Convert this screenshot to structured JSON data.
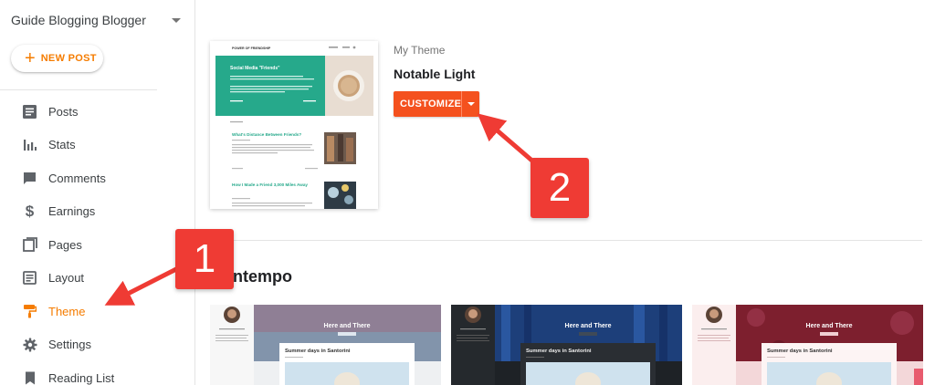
{
  "sidebar": {
    "blog_name": "Guide Blogging Blogger",
    "new_post_label": "NEW POST",
    "items": [
      {
        "label": "Posts",
        "icon": "posts-icon"
      },
      {
        "label": "Stats",
        "icon": "stats-icon"
      },
      {
        "label": "Comments",
        "icon": "comments-icon"
      },
      {
        "label": "Earnings",
        "icon": "dollar-icon"
      },
      {
        "label": "Pages",
        "icon": "pages-icon"
      },
      {
        "label": "Layout",
        "icon": "layout-icon"
      },
      {
        "label": "Theme",
        "icon": "paint-roller-icon",
        "active": true
      },
      {
        "label": "Settings",
        "icon": "gear-icon"
      },
      {
        "label": "Reading List",
        "icon": "bookmark-icon"
      }
    ]
  },
  "theme": {
    "my_theme_label": "My Theme",
    "name": "Notable Light",
    "customize_label": "CUSTOMIZE",
    "preview": {
      "site_title": "POWER OF FRIENDSHIP",
      "featured_title": "Social Media \"Friends\"",
      "post_1_title": "What's Distance Between Friends?",
      "post_2_title": "How I Made a Friend 3,000 Miles Away"
    }
  },
  "gallery": {
    "section_title": "ntempo",
    "cards": [
      {
        "blog_title": "Here and There",
        "post_title": "Summer days in Santorini"
      },
      {
        "blog_title": "Here and There",
        "post_title": "Summer days in Santorini"
      },
      {
        "blog_title": "Here and There",
        "post_title": "Summer days in Santorini"
      }
    ]
  },
  "callouts": {
    "step_1": "1",
    "step_2": "2"
  },
  "colors": {
    "accent_orange": "#f57c00",
    "customize_button": "#f4511e",
    "callout_red": "#ef3b34",
    "notable_teal": "#26a98b"
  }
}
